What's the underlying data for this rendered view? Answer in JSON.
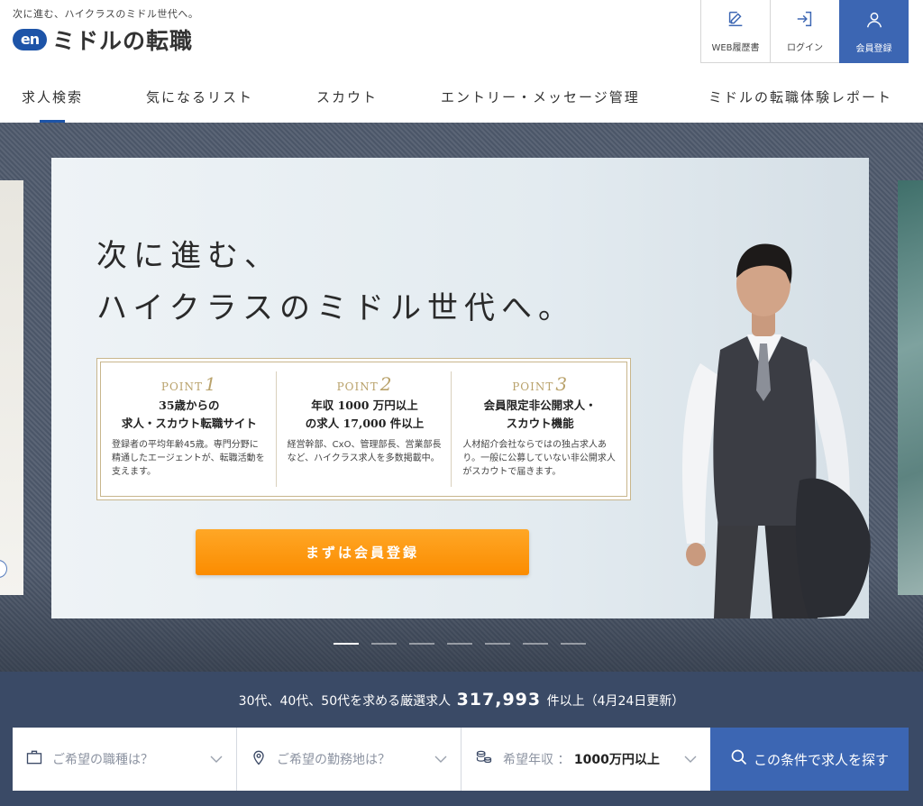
{
  "header": {
    "tagline": "次に進む、ハイクラスのミドル世代へ。",
    "logo_mark": "en",
    "logo_text": "ミドルの転職",
    "buttons": [
      {
        "label": "WEB履歴書",
        "icon": "edit-icon"
      },
      {
        "label": "ログイン",
        "icon": "login-icon"
      },
      {
        "label": "会員登録",
        "icon": "user-icon"
      }
    ]
  },
  "nav": {
    "items": [
      {
        "label": "求人検索",
        "active": true
      },
      {
        "label": "気になるリスト"
      },
      {
        "label": "スカウト"
      },
      {
        "label": "エントリー・メッセージ管理"
      },
      {
        "label": "ミドルの転職体験レポート"
      }
    ]
  },
  "hero": {
    "headline_line1": "次に進む、",
    "headline_line2": "ハイクラスのミドル世代へ。",
    "points": [
      {
        "label": "POINT",
        "num": "1",
        "title": "35歳からの\n求人・スカウト転職サイト",
        "desc": "登録者の平均年齢45歳。専門分野に精通したエージェントが、転職活動を支えます。"
      },
      {
        "label": "POINT",
        "num": "2",
        "title": "年収 1000 万円以上\nの求人 17,000 件以上",
        "desc": "経営幹部、CxO、管理部長、営業部長など、ハイクラス求人を多数掲載中。"
      },
      {
        "label": "POINT",
        "num": "3",
        "title": "会員限定非公開求人・\nスカウト機能",
        "desc": "人材紹介会社ならではの独占求人あり。一般に公募していない非公開求人がスカウトで届きます。"
      }
    ],
    "cta_label": "まずは会員登録",
    "slide_count": 7,
    "active_slide": 1
  },
  "search": {
    "message_prefix": "30代、40代、50代を求める厳選求人",
    "count": "317,993",
    "message_suffix": "件以上（4月24日更新）",
    "job_placeholder": "ご希望の職種は？",
    "location_placeholder": "ご希望の勤務地は？",
    "salary_label": "希望年収 ：",
    "salary_value": "1000万円以上",
    "submit_label": "この条件で求人を探す"
  },
  "colors": {
    "brand_blue": "#3c66b3",
    "logo_blue": "#1d54a8",
    "cta_orange": "#fb8c00",
    "band_navy": "#3a4a66",
    "gold": "#b9a26b"
  }
}
